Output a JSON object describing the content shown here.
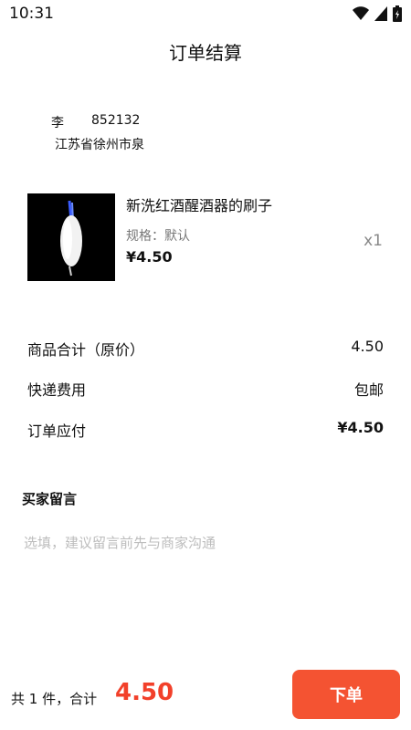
{
  "status_bar": {
    "time": "10:31",
    "icons": [
      "wifi-icon",
      "signal-icon",
      "battery-icon"
    ]
  },
  "header": {
    "title": "订单结算"
  },
  "address": {
    "name": "李",
    "phone": "852132",
    "line": "江苏省徐州市泉"
  },
  "product": {
    "image": "product-thumbnail-image",
    "name": "新洗红酒醒酒器的刷子",
    "spec": "规格：默认",
    "price": "¥4.50",
    "quantity": "x1"
  },
  "summary": {
    "subtotal_label": "商品合计（原价）",
    "subtotal_value": "4.50",
    "shipping_label": "快递费用",
    "shipping_value": "包邮",
    "payable_label": "订单应付",
    "payable_value": "¥4.50"
  },
  "message": {
    "label": "买家留言",
    "placeholder": "选填，建议留言前先与商家沟通"
  },
  "footer": {
    "total_text": "共 1 件，合计",
    "total_amount": "4.50",
    "order_button": "下单"
  },
  "colors": {
    "accent": "#f45332",
    "price_red": "#f2402a"
  }
}
